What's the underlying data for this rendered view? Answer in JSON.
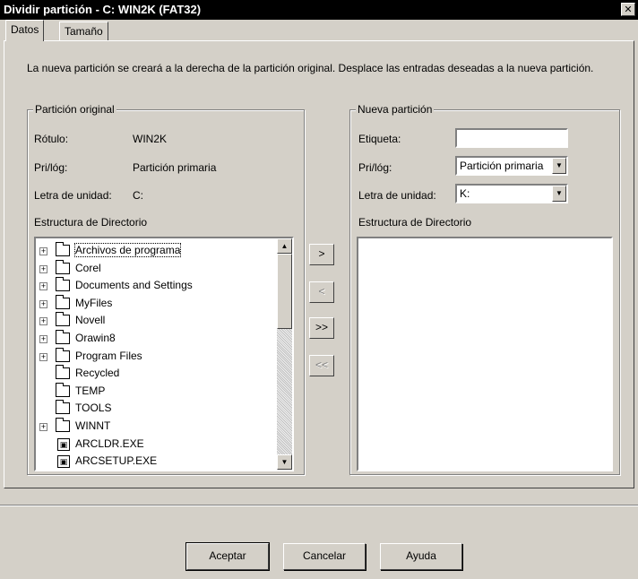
{
  "window": {
    "title": "Dividir partición - C: WIN2K (FAT32)",
    "close_glyph": "✕"
  },
  "tabs": [
    {
      "label": "Datos",
      "active": true
    },
    {
      "label": "Tamaño",
      "active": false
    }
  ],
  "description": "La nueva partición se creará a la derecha de la partición original. Desplace las entradas deseadas a la nueva partición.",
  "original": {
    "legend": "Partición original",
    "label_label": "Rótulo:",
    "label_value": "WIN2K",
    "type_label": "Pri/lóg:",
    "type_value": "Partición primaria",
    "drive_label": "Letra de unidad:",
    "drive_value": "C:",
    "dir_label": "Estructura de Directorio",
    "tree": [
      {
        "name": "Archivos de programa",
        "kind": "folder",
        "expandable": true,
        "selected": true
      },
      {
        "name": "Corel",
        "kind": "folder",
        "expandable": true
      },
      {
        "name": "Documents and Settings",
        "kind": "folder",
        "expandable": true
      },
      {
        "name": "MyFiles",
        "kind": "folder",
        "expandable": true
      },
      {
        "name": "Novell",
        "kind": "folder",
        "expandable": true
      },
      {
        "name": "Orawin8",
        "kind": "folder",
        "expandable": true
      },
      {
        "name": "Program Files",
        "kind": "folder",
        "expandable": true
      },
      {
        "name": "Recycled",
        "kind": "folder",
        "expandable": false
      },
      {
        "name": "TEMP",
        "kind": "folder",
        "expandable": false
      },
      {
        "name": "TOOLS",
        "kind": "folder",
        "expandable": false
      },
      {
        "name": "WINNT",
        "kind": "folder",
        "expandable": true
      },
      {
        "name": "ARCLDR.EXE",
        "kind": "file",
        "expandable": false
      },
      {
        "name": "ARCSETUP.EXE",
        "kind": "file",
        "expandable": false
      }
    ]
  },
  "move_buttons": [
    {
      "label": ">",
      "enabled": true
    },
    {
      "label": "<",
      "enabled": false
    },
    {
      "label": ">>",
      "enabled": true
    },
    {
      "label": "<<",
      "enabled": false
    }
  ],
  "new": {
    "legend": "Nueva partición",
    "label_label": "Etiqueta:",
    "label_value": "",
    "type_label": "Pri/lóg:",
    "type_value": "Partición primaria",
    "drive_label": "Letra de unidad:",
    "drive_value": "K:",
    "dir_label": "Estructura de Directorio"
  },
  "buttons": {
    "accept": "Aceptar",
    "cancel": "Cancelar",
    "help": "Ayuda"
  }
}
